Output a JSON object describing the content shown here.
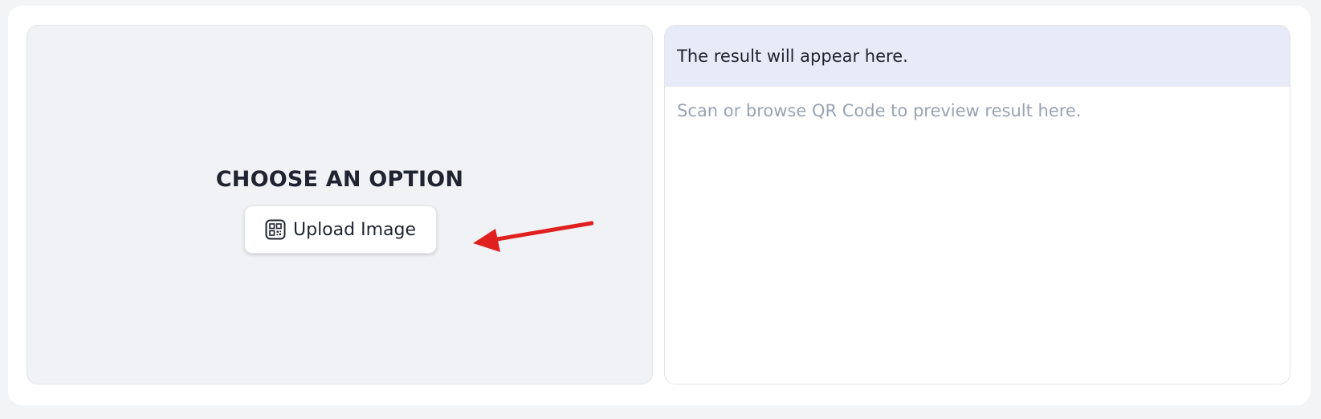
{
  "scanner": {
    "title": "CHOOSE AN OPTION",
    "upload_button": {
      "label": "Upload Image",
      "icon": "qr-code-icon"
    },
    "annotation": {
      "icon": "red-arrow-icon",
      "color": "#e0201f"
    }
  },
  "result": {
    "header": "The result will appear here.",
    "placeholder": "Scan or browse QR Code to preview result here."
  }
}
